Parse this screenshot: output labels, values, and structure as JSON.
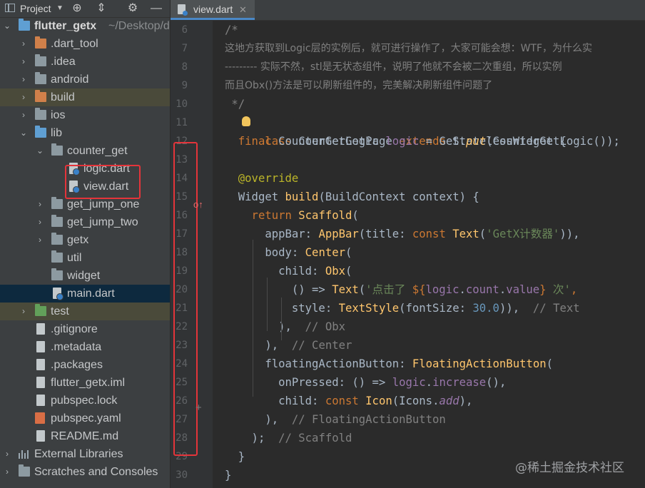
{
  "project_panel": {
    "title": "Project",
    "toolbar_icons": [
      "dropdown-icon",
      "locate-icon",
      "collapse-icon",
      "gear-icon",
      "minimize-icon"
    ]
  },
  "tree": [
    {
      "label": "flutter_getx",
      "suffix": "~/Desktop/de",
      "icon": "folder-blue-icon",
      "expanded": true
    },
    {
      "label": ".dart_tool",
      "icon": "folder-orange-icon"
    },
    {
      "label": ".idea",
      "icon": "folder-gray-icon"
    },
    {
      "label": "android",
      "icon": "folder-gray-icon"
    },
    {
      "label": "build",
      "icon": "folder-orange-icon"
    },
    {
      "label": "ios",
      "icon": "folder-gray-icon"
    },
    {
      "label": "lib",
      "icon": "folder-blue-icon",
      "expanded": true
    },
    {
      "label": "counter_get",
      "icon": "folder-gray-icon",
      "expanded": true
    },
    {
      "label": "logic.dart",
      "icon": "dart-file-icon"
    },
    {
      "label": "view.dart",
      "icon": "dart-file-icon"
    },
    {
      "label": "get_jump_one",
      "icon": "folder-gray-icon"
    },
    {
      "label": "get_jump_two",
      "icon": "folder-gray-icon"
    },
    {
      "label": "getx",
      "icon": "folder-gray-icon"
    },
    {
      "label": "util",
      "icon": "folder-gray-icon"
    },
    {
      "label": "widget",
      "icon": "folder-gray-icon"
    },
    {
      "label": "main.dart",
      "icon": "dart-file-icon",
      "selected": true
    },
    {
      "label": "test",
      "icon": "folder-green-icon"
    },
    {
      "label": ".gitignore",
      "icon": "file-icon"
    },
    {
      "label": ".metadata",
      "icon": "file-icon"
    },
    {
      "label": ".packages",
      "icon": "file-icon"
    },
    {
      "label": "flutter_getx.iml",
      "icon": "module-file-icon"
    },
    {
      "label": "pubspec.lock",
      "icon": "file-icon"
    },
    {
      "label": "pubspec.yaml",
      "icon": "yaml-file-icon"
    },
    {
      "label": "README.md",
      "icon": "markdown-file-icon"
    },
    {
      "label": "External Libraries",
      "icon": "libraries-icon"
    },
    {
      "label": "Scratches and Consoles",
      "icon": "scratches-icon"
    }
  ],
  "editor": {
    "tab_label": "view.dart",
    "line_numbers": [
      "6",
      "7",
      "8",
      "9",
      "10",
      "11",
      "12",
      "13",
      "14",
      "15",
      "16",
      "17",
      "18",
      "19",
      "20",
      "21",
      "22",
      "23",
      "24",
      "25",
      "26",
      "27",
      "28",
      "29",
      "30"
    ],
    "comment_open": "/*",
    "comment_line1": "这地方获取到Logic层的实例后，就可进行操作了，大家可能会想：WTF，为什么实",
    "comment_line2": "--------- 实际不然，stl是无状态组件，说明了他就不会被二次重组，所以实例",
    "comment_line3": "而且Obx()方法是可以刷新组件的，完美解决刷新组件问题了",
    "comment_close": " */",
    "l11": {
      "a": "c",
      "b": "ass ",
      "c": "CounterGetPage ",
      "d": "extends ",
      "e": "StatelessWidget {"
    },
    "l12": {
      "a": "  final ",
      "b": "CounterGetLogic ",
      "c": "logic",
      "d": " = Get.",
      "e": "put",
      "f": "(CounterGetLogic());"
    },
    "l14": "  @override",
    "l15": {
      "a": "  Widget ",
      "b": "build",
      "c": "(BuildContext context) {"
    },
    "l16": {
      "a": "    return ",
      "b": "Scaffold",
      "c": "("
    },
    "l17": {
      "a": "      appBar: ",
      "b": "AppBar",
      "c": "(title: ",
      "d": "const ",
      "e": "Text",
      "f": "(",
      "g": "'GetX计数器'",
      "h": ")),"
    },
    "l18": {
      "a": "      body: ",
      "b": "Center",
      "c": "("
    },
    "l19": {
      "a": "        child: ",
      "b": "Obx",
      "c": "("
    },
    "l20": {
      "a": "          () => ",
      "b": "Text",
      "c": "(",
      "d": "'点击了 ",
      "e": "${",
      "f": "logic",
      "g": ".",
      "h": "count",
      "i": ".",
      "j": "value",
      "k": "}",
      "l": " 次'",
      "m": ","
    },
    "l21": {
      "a": "          style: ",
      "b": "TextStyle",
      "c": "(fontSize: ",
      "d": "30.0",
      "e": ")),  ",
      "f": "// Text"
    },
    "l22": {
      "a": "        ),  ",
      "b": "// Obx"
    },
    "l23": {
      "a": "      ),  ",
      "b": "// Center"
    },
    "l24": {
      "a": "      floatingActionButton: ",
      "b": "FloatingActionButton",
      "c": "("
    },
    "l25": {
      "a": "        onPressed: () => ",
      "b": "logic",
      "c": ".",
      "d": "increase",
      "e": "(),"
    },
    "l26": {
      "a": "        child: ",
      "b": "const ",
      "c": "Icon",
      "d": "(Icons.",
      "e": "add",
      "f": "),"
    },
    "l27": {
      "a": "      ),  ",
      "b": "// FloatingActionButton"
    },
    "l28": {
      "a": "    );  ",
      "b": "// Scaffold"
    },
    "l29": "  }",
    "l30": "}"
  },
  "watermark": "@稀土掘金技术社区",
  "colors": {
    "annotation_box": "#e4343a",
    "selection": "#0d293e",
    "keyword": "#cc7832",
    "string": "#6a8759",
    "number": "#6897bb",
    "comment": "#808080",
    "function": "#ffc66d",
    "field": "#9876aa"
  }
}
